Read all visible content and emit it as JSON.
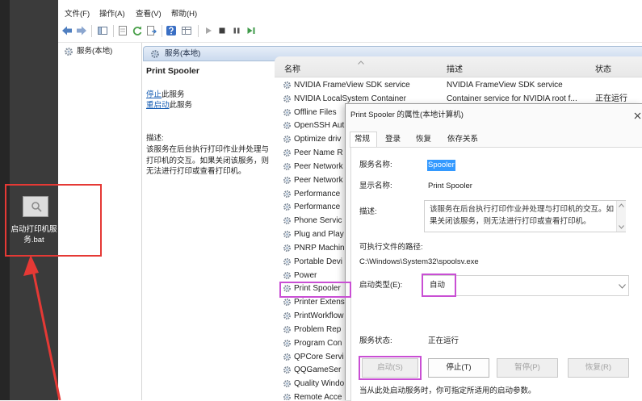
{
  "desktop": {
    "icon_label": "启动打印机服务.bat"
  },
  "menu": {
    "file": "文件(F)",
    "action": "操作(A)",
    "view": "查看(V)",
    "help": "帮助(H)"
  },
  "toolbar_icons": [
    "back-arrow-icon",
    "forward-arrow-icon",
    "console-tree-icon",
    "show-hide-icon",
    "refresh-icon",
    "export-list-icon",
    "help-icon",
    "properties-icon",
    "start-service-icon",
    "stop-service-icon",
    "pause-service-icon",
    "restart-service-icon"
  ],
  "tree": {
    "root_label": "服务(本地)"
  },
  "pane": {
    "header": "服务(本地)"
  },
  "detail": {
    "service_name": "Print Spooler",
    "stop_link": "停止",
    "stop_suffix": "此服务",
    "restart_link": "重启动",
    "restart_suffix": "此服务",
    "description_label": "描述:",
    "description": "该服务在后台执行打印作业并处理与打印机的交互。如果关闭该服务，则无法进行打印或查看打印机。"
  },
  "list": {
    "columns": {
      "name": "名称",
      "description": "描述",
      "status": "状态"
    },
    "rows": [
      {
        "name": "NVIDIA FrameView SDK service",
        "description": "NVIDIA FrameView SDK service"
      },
      {
        "name": "NVIDIA LocalSystem Container",
        "description": "Container service for NVIDIA root f...",
        "status": "正在运行"
      },
      {
        "name": "Offline Files"
      },
      {
        "name": "OpenSSH Aut"
      },
      {
        "name": "Optimize driv"
      },
      {
        "name": "Peer Name R"
      },
      {
        "name": "Peer Network"
      },
      {
        "name": "Peer Network"
      },
      {
        "name": "Performance"
      },
      {
        "name": "Performance"
      },
      {
        "name": "Phone Servic"
      },
      {
        "name": "Plug and Play"
      },
      {
        "name": "PNRP Machin"
      },
      {
        "name": "Portable Devi"
      },
      {
        "name": "Power"
      },
      {
        "name": "Print Spooler"
      },
      {
        "name": "Printer Extens"
      },
      {
        "name": "PrintWorkflow"
      },
      {
        "name": "Problem Rep"
      },
      {
        "name": "Program Con"
      },
      {
        "name": "QPCore Servi"
      },
      {
        "name": "QQGameSer"
      },
      {
        "name": "Quality Windo"
      },
      {
        "name": "Remote Acce"
      }
    ]
  },
  "dialog": {
    "title": "Print Spooler 的属性(本地计算机)",
    "tabs": [
      "常规",
      "登录",
      "恢复",
      "依存关系"
    ],
    "active_tab_index": 0,
    "service_name_label": "服务名称:",
    "service_name_value": "Spooler",
    "display_name_label": "显示名称:",
    "display_name_value": "Print Spooler",
    "description_label": "描述:",
    "description_value": "该服务在后台执行打印作业并处理与打印机的交互。如果关闭该服务，则无法进行打印或查看打印机。",
    "path_label": "可执行文件的路径:",
    "path_value": "C:\\Windows\\System32\\spoolsv.exe",
    "startup_type_label": "启动类型(E):",
    "startup_type_value": "自动",
    "status_label": "服务状态:",
    "status_value": "正在运行",
    "buttons": {
      "start": "启动(S)",
      "stop": "停止(T)",
      "pause": "暂停(P)",
      "resume": "恢复(R)"
    },
    "hint": "当从此处启动服务时，你可指定所适用的启动参数。"
  },
  "colors": {
    "desktop_bg": "#3b3b3b",
    "pane_header": "#cbdaee",
    "link": "#1a5fb4",
    "text_selection": "#3399ff",
    "annotation_magenta": "#c94fd4",
    "annotation_red": "#e53935",
    "disabled_text": "#a3a3a3"
  }
}
